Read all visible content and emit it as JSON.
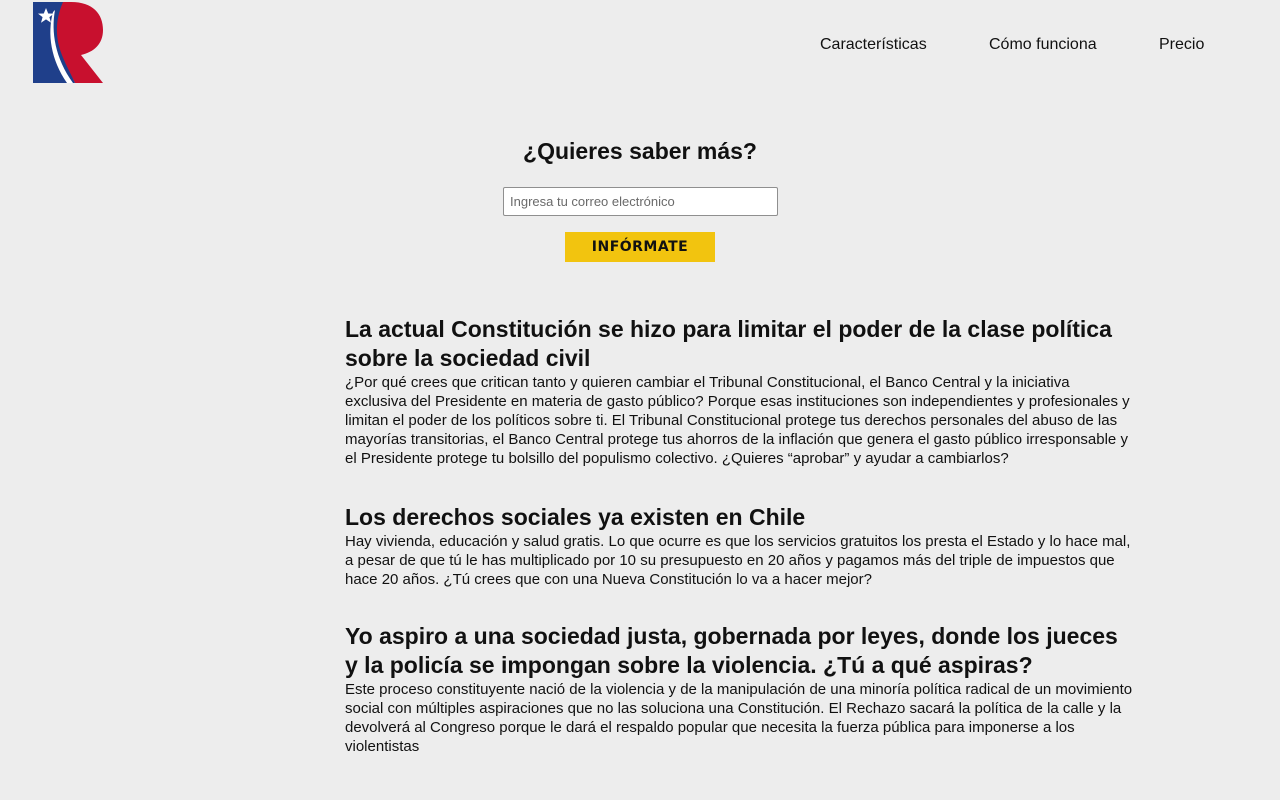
{
  "brand": {
    "logo_icon": "r-flag-logo-icon",
    "colors": {
      "blue": "#1f3f8a",
      "red": "#c8102e",
      "white": "#ffffff"
    }
  },
  "nav": {
    "items": [
      {
        "label": "Características"
      },
      {
        "label": "Cómo funciona"
      },
      {
        "label": "Precio"
      }
    ]
  },
  "signup": {
    "title": "¿Quieres saber más?",
    "email_placeholder": "Ingresa tu correo electrónico",
    "email_value": "",
    "button_label": "INFÓRMATE",
    "button_color": "#f2c40f"
  },
  "sections": [
    {
      "heading": "La actual Constitución se hizo para limitar el poder de la clase política sobre la sociedad civil",
      "body": "¿Por qué crees que critican tanto y quieren cambiar el Tribunal Constitucional, el Banco Central y la iniciativa exclusiva del Presidente en materia de gasto público? Porque esas instituciones son independientes y profesionales y limitan el poder de los políticos sobre ti. El Tribunal Constitucional protege tus derechos personales del abuso de las mayorías transitorias, el Banco Central protege tus ahorros de la inflación que genera el gasto público irresponsable y el Presidente protege tu bolsillo del populismo colectivo. ¿Quieres “aprobar” y ayudar a cambiarlos?"
    },
    {
      "heading": "Los derechos sociales ya existen en Chile",
      "body": "Hay vivienda, educación y salud gratis. Lo que ocurre es que los servicios gratuitos los presta el Estado y lo hace mal, a pesar de que tú le has multiplicado por 10 su presupuesto en 20 años y pagamos más del triple de impuestos que hace 20 años. ¿Tú crees que con una Nueva Constitución lo va a hacer mejor?"
    },
    {
      "heading": "Yo aspiro a una sociedad justa, gobernada por leyes, donde los jueces y la policía se impongan sobre la violencia. ¿Tú a qué aspiras?",
      "body": "Este proceso constituyente nació de la violencia y de la manipulación de una minoría política radical de un movimiento social con múltiples aspiraciones que no las soluciona una Constitución. El Rechazo sacará la política de la calle y la devolverá al Congreso porque le dará el respaldo popular que necesita la fuerza pública para imponerse a los violentistas"
    }
  ]
}
